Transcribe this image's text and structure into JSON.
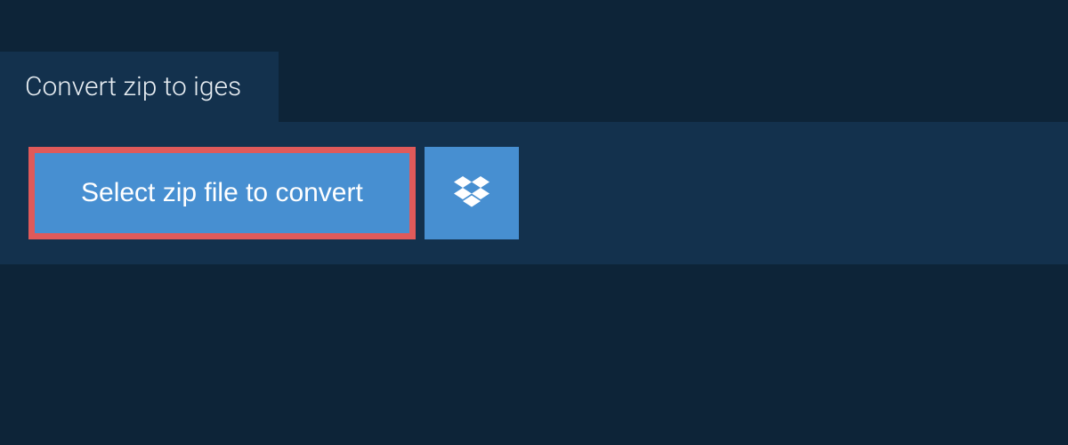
{
  "header": {
    "title": "Convert zip to iges"
  },
  "actions": {
    "select_file_label": "Select zip file to convert",
    "dropbox_icon_name": "dropbox-icon"
  },
  "colors": {
    "page_bg": "#0d2438",
    "panel_bg": "#13314d",
    "button_bg": "#478fd1",
    "highlight_border": "#e05a5a",
    "text_light": "#e8eef3",
    "text_white": "#ffffff"
  }
}
